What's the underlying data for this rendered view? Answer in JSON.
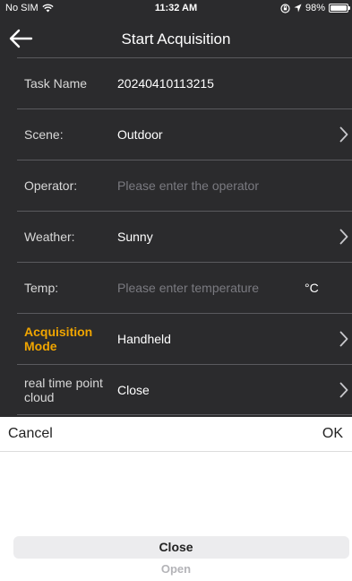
{
  "status": {
    "carrier": "No SIM",
    "time": "11:32 AM",
    "battery": "98%",
    "battery_level": 0.98
  },
  "nav": {
    "title": "Start Acquisition"
  },
  "form": {
    "task_name": {
      "label": "Task Name",
      "value": "20240410113215"
    },
    "scene": {
      "label": "Scene:",
      "value": "Outdoor"
    },
    "operator": {
      "label": "Operator:",
      "placeholder": "Please enter the operator"
    },
    "weather": {
      "label": "Weather:",
      "value": "Sunny"
    },
    "temp": {
      "label": "Temp:",
      "placeholder": "Please enter temperature",
      "unit": "°C"
    },
    "acq_mode": {
      "label": "Acquisition Mode",
      "value": "Handheld"
    },
    "realtime": {
      "label": "real time point cloud",
      "value": "Close"
    }
  },
  "picker": {
    "cancel": "Cancel",
    "ok": "OK",
    "options": [
      "Close",
      "Open"
    ],
    "selected": "Close"
  },
  "colors": {
    "background": "#2b2b2d",
    "accent": "#f0a500"
  }
}
